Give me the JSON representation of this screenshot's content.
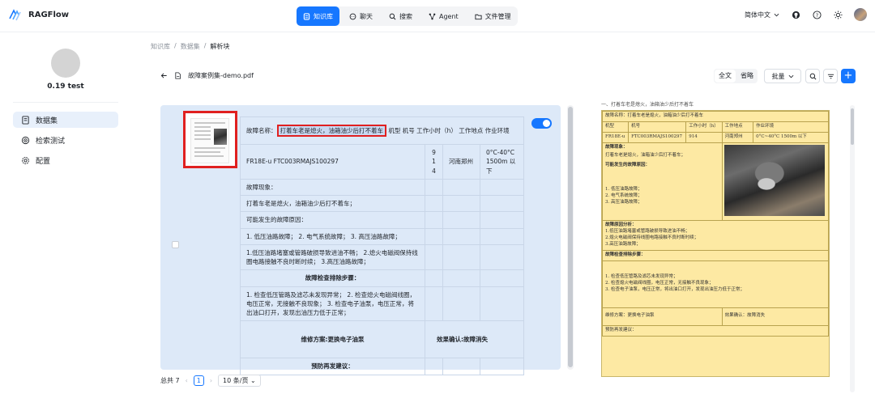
{
  "app": {
    "name": "RAGFlow"
  },
  "nav": {
    "items": [
      {
        "label": "知识库",
        "icon": "database-icon",
        "active": true
      },
      {
        "label": "聊天",
        "icon": "chat-icon"
      },
      {
        "label": "搜索",
        "icon": "search-icon"
      },
      {
        "label": "Agent",
        "icon": "agent-icon"
      },
      {
        "label": "文件管理",
        "icon": "folder-icon"
      }
    ]
  },
  "header_tools": {
    "language": "简体中文"
  },
  "sidebar": {
    "kb_name": "0.19 test",
    "items": [
      {
        "label": "数据集",
        "icon": "dataset-icon",
        "active": true
      },
      {
        "label": "检索测试",
        "icon": "retrieval-icon"
      },
      {
        "label": "配置",
        "icon": "settings-icon"
      }
    ]
  },
  "breadcrumb": [
    "知识库",
    "数据集",
    "解析块"
  ],
  "document": {
    "name": "故障案例集-demo.pdf"
  },
  "toolbar": {
    "mode_full": "全文",
    "mode_brief": "省略",
    "batch_label": "批量"
  },
  "chunk": {
    "enabled": true,
    "rows": {
      "r1_prefix": "故障名称：",
      "r1_highlight": "打着车老是熄火，油箱油少后打不着车",
      "r1_suffix": " 机型 机号 工作小时（h） 工作地点 作业环境",
      "r2_model": "FR18E-u FTC003RMAJS100297",
      "r2_hours": "9 1 4",
      "r2_place": "河南郑州",
      "r2_env": "0°C-40°C 1500m 以下",
      "r3": "故障现象：",
      "r4": "打着车老是熄火，油箱油少后打不着车；",
      "r5": "可能发生的故障原因：",
      "r6": "1. 低压油路故障； 2. 电气系统故障； 3. 高压油路故障；",
      "r7": "1.低压油路堵塞或管路破损导致进油不畅； 2.熄火电磁阀保持线圈电路接触不良时断时续； 3.高压油路故障；",
      "r8": "故障检查排除步骤：",
      "r9": "1. 检查低压管路及滤芯未发现异常； 2. 检查熄火电磁阀线圈，电压正常，无接触不良现象； 3. 检查电子油泵，电压正常，将出油口打开，发现出油压力低于正常；",
      "r10_plan": "维修方案:更换电子油泵",
      "r10_result": "效果确认:故障消失",
      "r11": "预防再发建议："
    }
  },
  "pagination": {
    "total": "总共 7",
    "page": "1",
    "size": "10 条/页"
  },
  "pdf": {
    "top_text": "一、打着车老是熄火，油箱油少后打不着车",
    "name_row": "故障名称：打着车老是熄火，油箱油少后打不着车",
    "headers": [
      "机型",
      "机号",
      "工作小时（h）",
      "工作地点",
      "作业环境"
    ],
    "values": [
      "FR18E-u",
      "FTC003RMAJS100297",
      "914",
      "河南郑州",
      "0°C~40°C 1500m 以下"
    ],
    "symptom_label": "故障现象：",
    "symptom": "打着车老是熄火，油箱油少后打不着车；",
    "cause_label": "可能发生的故障原因：",
    "causes": [
      "1. 低压油路故障；",
      "2. 电气系统故障；",
      "3. 高压油路故障；"
    ],
    "analysis_label": "故障原因分析：",
    "analysis": [
      "1.低压油路堵塞或管路破损导致进油不畅；",
      "2.熄火电磁阀保持线圈电路接触不良时断时续；",
      "3.高压油路故障；"
    ],
    "steps_label": "故障检查排除步骤：",
    "steps": [
      "1. 检查低压管路及滤芯未发现异常；",
      "2. 检查熄火电磁阀线圈，电压正常，无接触不良现象；",
      "3. 检查电子油泵，电压正常，将出油口打开，发现出油压力低于正常；"
    ],
    "plan": "维修方案：更换电子油泵",
    "result": "效果确认：故障消失",
    "prevent": "预防再发建议："
  }
}
